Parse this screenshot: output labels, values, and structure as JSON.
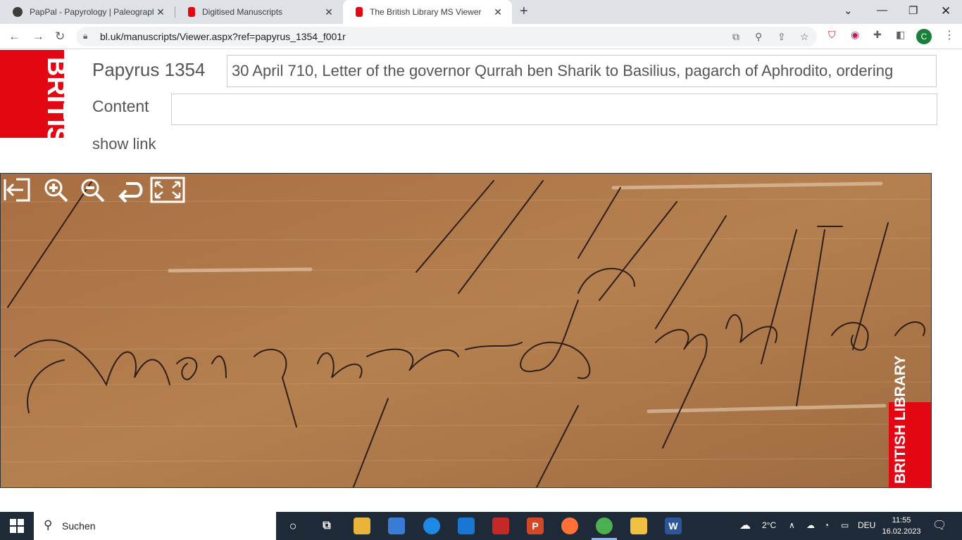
{
  "browser": {
    "tabs": [
      {
        "title": "PapPal - Papyrology | Paleograph",
        "active": false,
        "favicon_color": "#3c3c3c",
        "favicon_icon": "pappal-icon"
      },
      {
        "title": "Digitised Manuscripts",
        "active": false,
        "favicon_color": "#e30613",
        "favicon_icon": "british-library-icon"
      },
      {
        "title": "The British Library MS Viewer",
        "active": true,
        "favicon_color": "#e30613",
        "favicon_icon": "british-library-icon"
      }
    ],
    "url": "bl.uk/manuscripts/Viewer.aspx?ref=papyrus_1354_f001r",
    "profile_initial": "C"
  },
  "page": {
    "logo_text": "BRITISH LIBRARY",
    "manuscript_title": "Papyrus 1354",
    "description": "30 April 710, Letter of the governor Qurrah ben Sharik to Basilius, pagarch of Aphrodito, ordering",
    "content_label": "Content",
    "content_value": "",
    "show_link": "show link"
  },
  "viewer": {
    "controls": [
      "exit-icon",
      "zoom-in-icon",
      "zoom-out-icon",
      "rotate-icon",
      "fullscreen-icon"
    ],
    "corner_logo_text": "BRITISH LIBRARY"
  },
  "taskbar": {
    "search_placeholder": "Suchen",
    "weather": "2°C",
    "language": "DEU",
    "time": "11:55",
    "date": "16.02.2023"
  },
  "colors": {
    "bl_red": "#e30613",
    "papyrus": "#b07a4e",
    "taskbar": "#1f2a38"
  }
}
